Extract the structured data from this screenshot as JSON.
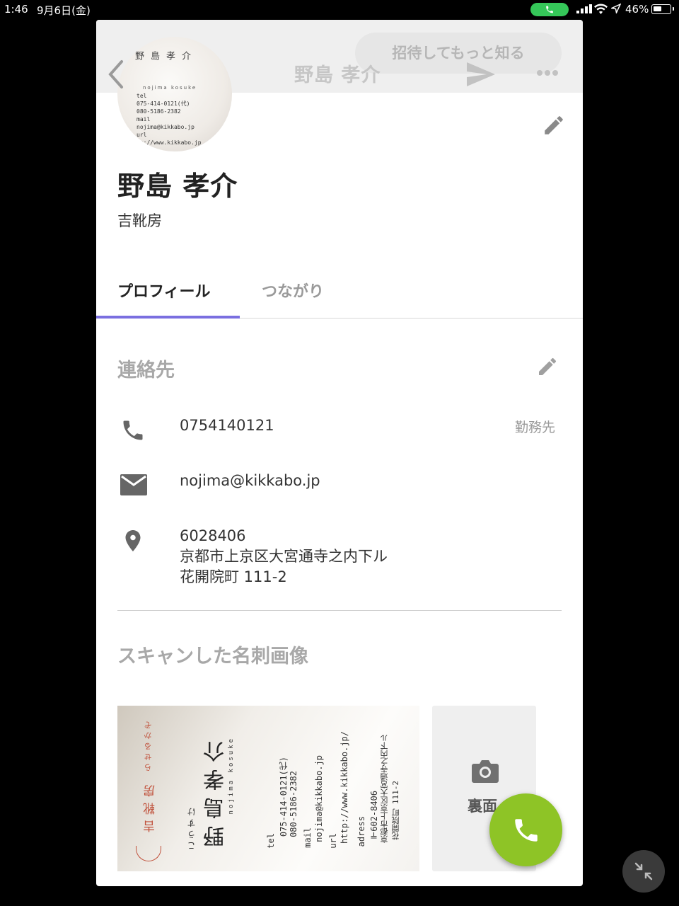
{
  "status_bar": {
    "time": "1:46",
    "date": "9月6日(金)",
    "battery": "46%",
    "call_pill_color": "#35c759"
  },
  "header": {
    "title": "野島 孝介",
    "invite_button": "招待してもっと知る",
    "back_icon": "chevron-left-icon",
    "send_icon": "send-icon",
    "more_icon": "more-horizontal-icon"
  },
  "profile": {
    "name": "野島 孝介",
    "company": "吉靴房",
    "avatar_card": {
      "name_vertical": [
        "介",
        "孝",
        "島",
        "野"
      ],
      "romaji": "nojima  kosuke",
      "lines": [
        "tel",
        "075-414-0121(代)",
        "080-5186-2382",
        "mail",
        "nojima@kikkabo.jp",
        "url",
        "tp://www.kikkabo.jp"
      ]
    }
  },
  "tabs": [
    {
      "label": "プロフィール",
      "active": true
    },
    {
      "label": "つながり",
      "active": false
    }
  ],
  "accent_color": "#7a6fe0",
  "contacts": {
    "title": "連絡先",
    "phone": {
      "value": "0754140121",
      "type": "勤務先"
    },
    "email": {
      "value": "nojima@kikkabo.jp"
    },
    "address": {
      "postal": "6028406",
      "line1": "京都市上京区大宮通寺之内下ル",
      "line2": "花開院町 111-2"
    }
  },
  "scan": {
    "title": "スキャンした名刺画像",
    "front_card": {
      "red_small": "らせるかぞ",
      "red_brand": "吉靴房",
      "name": "野島孝介",
      "name_kana": "こうすけ",
      "romaji": "nojima kosuke",
      "tel_label": "tel",
      "tel1": "075-414-0121(代)",
      "tel2": "080-5186-2382",
      "mail_label": "mail",
      "mail": "nojima@kikkabo.jp",
      "url_label": "url",
      "url": "http://www.kikkabo.jp/",
      "adress_label": "adress",
      "postal": "〒602-8406",
      "addr1": "京都市上京区大宮通寺之内下ル",
      "addr2": "花開院町 111-2"
    },
    "back_label": "裏面",
    "camera_icon": "camera-icon"
  },
  "fab": {
    "icon": "phone-icon",
    "color": "#8ec426"
  }
}
